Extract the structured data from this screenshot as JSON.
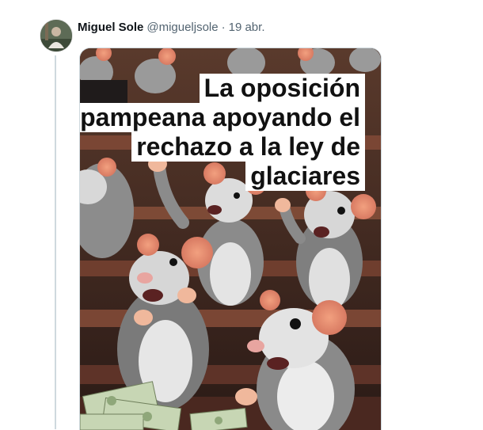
{
  "tweet": {
    "author_name": "Miguel Sole",
    "handle": "@migueljsole",
    "separator": "·",
    "date": "19 abr.",
    "avatar_icon": "profile-avatar",
    "image": {
      "caption_lines": [
        "La oposición",
        "pampeana apoyando el",
        "rechazo a la ley de",
        "glaciares"
      ],
      "description_icon": "rats-in-parliament-illustration"
    }
  },
  "colors": {
    "text_primary": "#0f1419",
    "text_secondary": "#536471",
    "thread_line": "#cfd9de"
  }
}
